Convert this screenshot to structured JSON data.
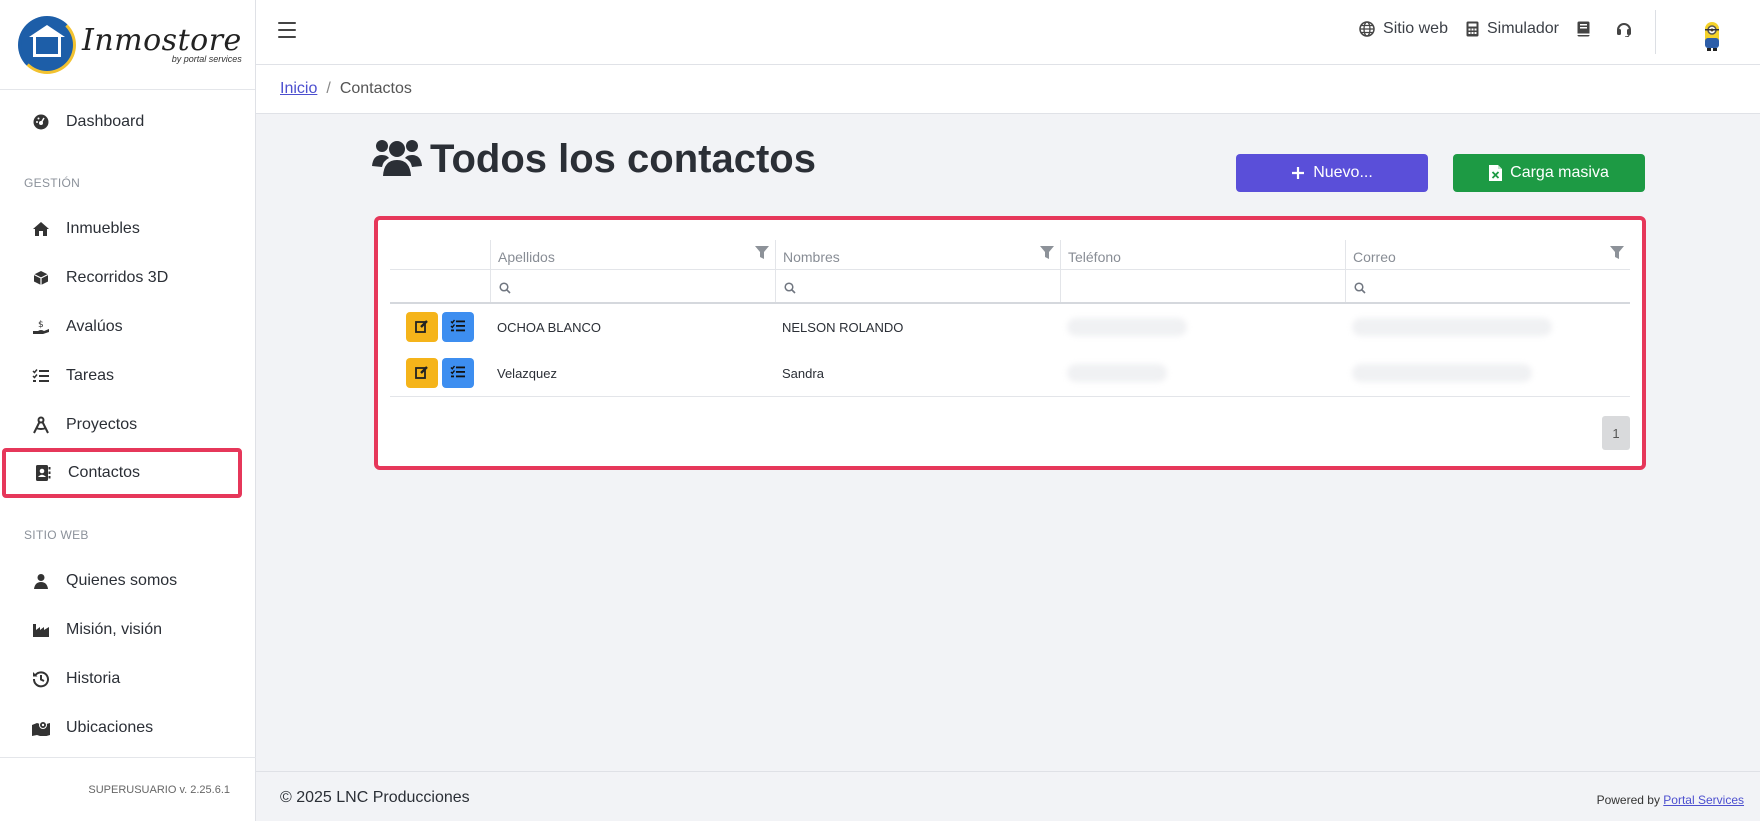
{
  "brand": {
    "name": "Inmostore",
    "tagline": "by portal services"
  },
  "sidebar": {
    "dashboard": "Dashboard",
    "section_gestion": "GESTIÓN",
    "gestion_items": [
      {
        "label": "Inmuebles",
        "icon": "home-icon"
      },
      {
        "label": "Recorridos 3D",
        "icon": "cube-icon"
      },
      {
        "label": "Avalúos",
        "icon": "hand-money-icon"
      },
      {
        "label": "Tareas",
        "icon": "tasks-icon"
      },
      {
        "label": "Proyectos",
        "icon": "compass-icon"
      },
      {
        "label": "Contactos",
        "icon": "address-book-icon"
      }
    ],
    "section_web": "SITIO WEB",
    "web_items": [
      {
        "label": "Quienes somos",
        "icon": "user-icon"
      },
      {
        "label": "Misión, visión",
        "icon": "industry-icon"
      },
      {
        "label": "Historia",
        "icon": "history-icon"
      },
      {
        "label": "Ubicaciones",
        "icon": "map-icon"
      }
    ],
    "version": "SUPERUSUARIO v. 2.25.6.1"
  },
  "topbar": {
    "links": [
      {
        "label": "Sitio web",
        "icon": "globe-icon"
      },
      {
        "label": "Simulador",
        "icon": "calculator-icon"
      }
    ]
  },
  "breadcrumb": {
    "home": "Inicio",
    "current": "Contactos"
  },
  "page": {
    "title": "Todos los contactos",
    "new_button": "Nuevo...",
    "bulk_button": "Carga masiva"
  },
  "grid": {
    "columns": [
      "Apellidos",
      "Nombres",
      "Teléfono",
      "Correo"
    ],
    "rows": [
      {
        "apellidos": "OCHOA BLANCO",
        "nombres": "NELSON ROLANDO"
      },
      {
        "apellidos": "Velazquez",
        "nombres": "Sandra"
      }
    ],
    "page_number": "1"
  },
  "footer": {
    "copyright": "© 2025 LNC Producciones",
    "powered_prefix": "Powered by",
    "powered_link": "Portal Services"
  },
  "colors": {
    "highlight": "#e6375a",
    "primary": "#5a4fd9",
    "success": "#1d9a44",
    "warning": "#f5b41a",
    "info": "#3d8ef0"
  }
}
